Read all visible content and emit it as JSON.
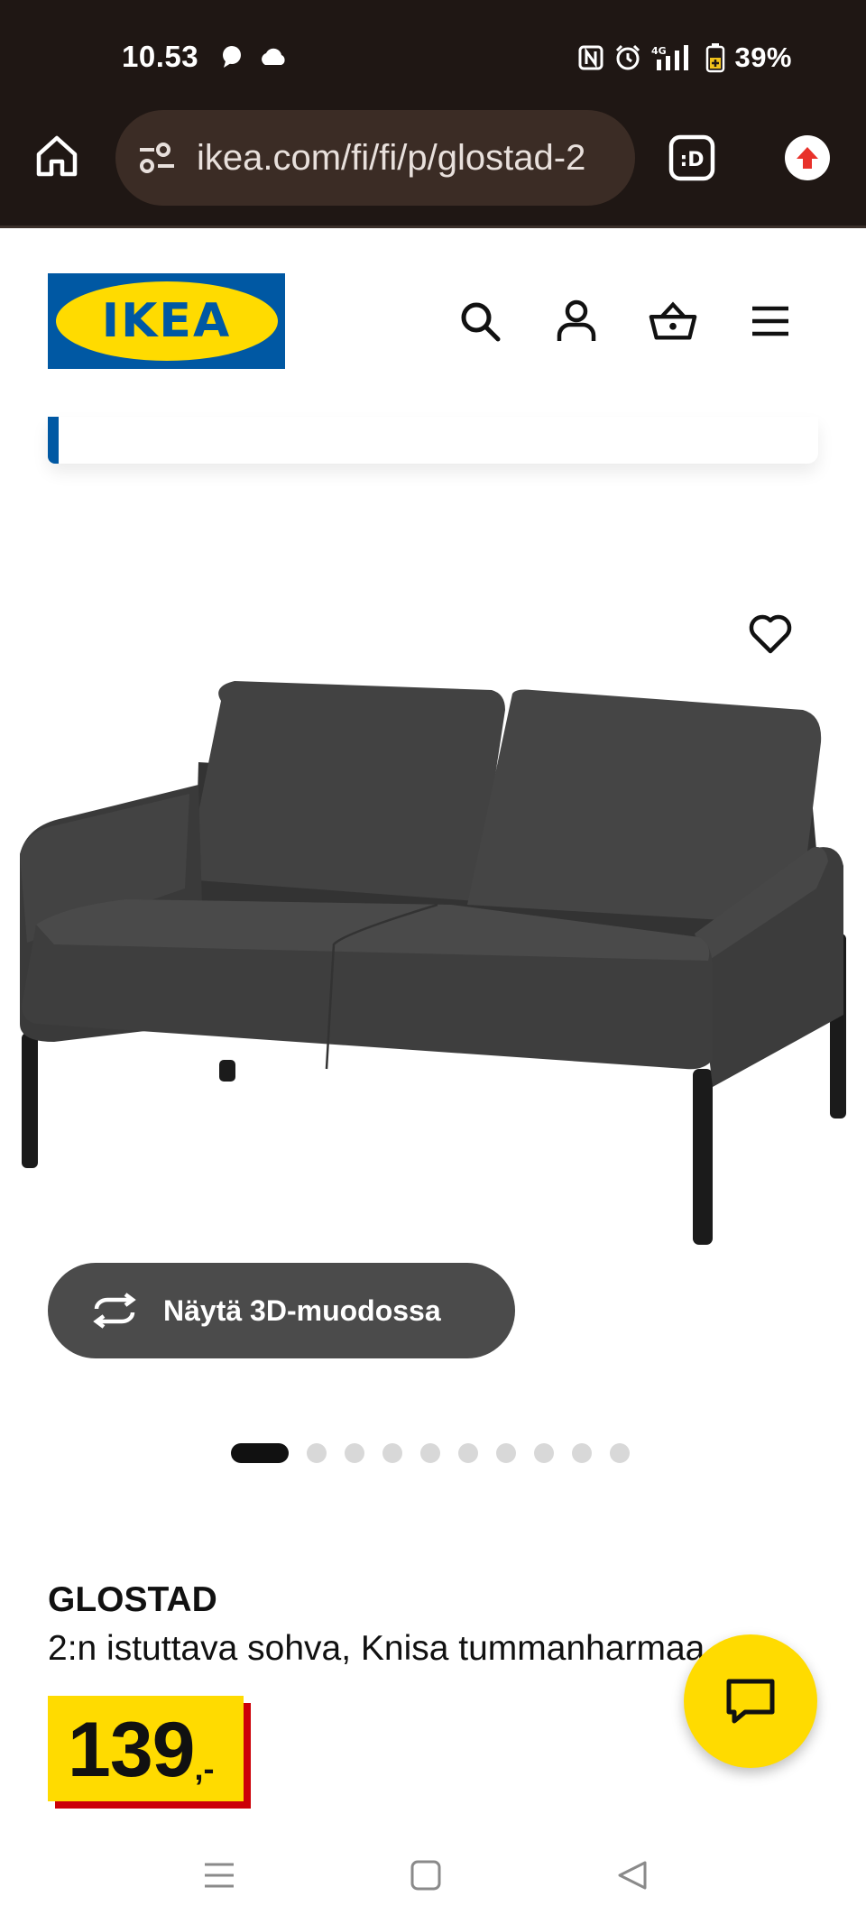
{
  "status_bar": {
    "time": "10.53",
    "battery": "39%",
    "network": "4G",
    "icons": [
      "chat-bubble-icon",
      "cloud-icon",
      "nfc-icon",
      "alarm-icon",
      "signal-icon",
      "battery-saver-icon"
    ]
  },
  "browser": {
    "url": "ikea.com/fi/fi/p/glostad-2",
    "tabs_icon_label": ":D",
    "icons": [
      "home-icon",
      "site-settings-icon",
      "tab-switcher-icon",
      "update-icon"
    ]
  },
  "header": {
    "logo_text": "IKEA",
    "icons": [
      "search-icon",
      "account-icon",
      "cart-icon",
      "menu-icon"
    ]
  },
  "gallery": {
    "view_3d_label": "Näytä 3D-muodossa",
    "image_count": 10,
    "active_index": 0
  },
  "product": {
    "name": "GLOSTAD",
    "description": "2:n istuttava sohva, Knisa tummanharmaa",
    "price_integer": "139",
    "price_suffix": ",-"
  },
  "colors": {
    "ikea_blue": "#0058a3",
    "ikea_yellow": "#ffdb00",
    "price_red": "#cc0008",
    "chrome_bg": "#1f1714"
  }
}
